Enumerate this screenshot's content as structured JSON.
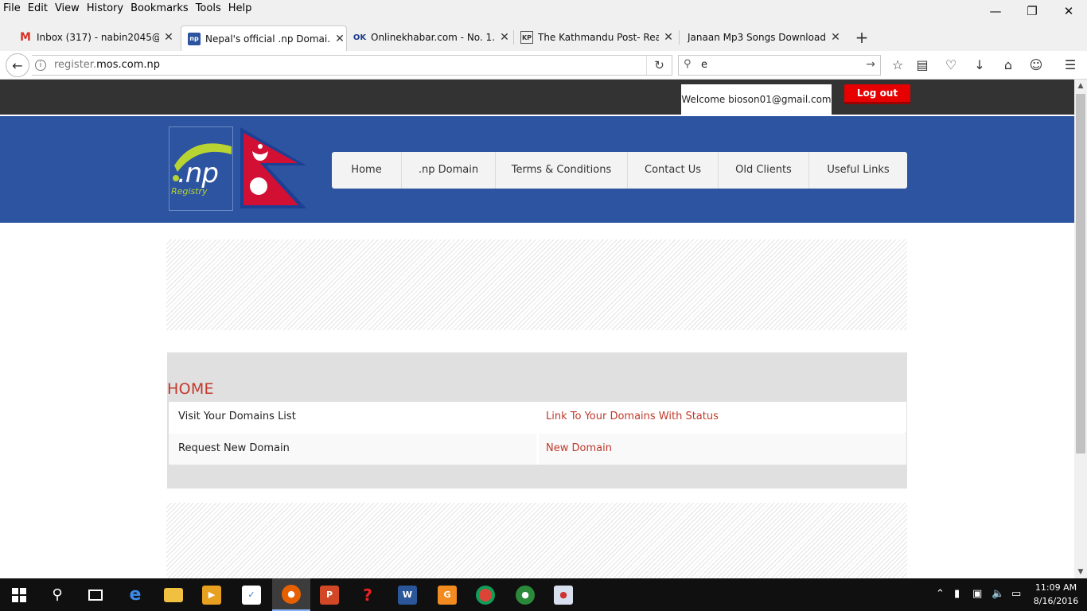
{
  "menubar": {
    "items": [
      "File",
      "Edit",
      "View",
      "History",
      "Bookmarks",
      "Tools",
      "Help"
    ]
  },
  "tabs": [
    {
      "title": "Inbox (317) - nabin2045@...",
      "favicon": "gmail-icon",
      "active": false
    },
    {
      "title": "Nepal's official .np Domai...",
      "favicon": "np-registry-icon",
      "active": true
    },
    {
      "title": "Onlinekhabar.com - No. 1...",
      "favicon": "onlinekhabar-icon",
      "active": false
    },
    {
      "title": "The Kathmandu Post- Rea...",
      "favicon": "kathmandu-post-icon",
      "active": false
    },
    {
      "title": "Janaan Mp3 Songs Download ...",
      "favicon": "blank-page-icon",
      "active": false
    }
  ],
  "navbar": {
    "url_prefix": "register.",
    "url_domain": "mos.com.np",
    "search_value": "e"
  },
  "page": {
    "welcome": "Welcome bioson01@gmail.com",
    "logout": "Log out",
    "logo_text": ".np",
    "logo_sub": "Registry",
    "nav": [
      "Home",
      ".np Domain",
      "Terms & Conditions",
      "Contact Us",
      "Old Clients",
      "Useful Links"
    ],
    "section_title": "HOME",
    "rows": [
      {
        "label": "Visit Your Domains List",
        "link": "Link To Your Domains With Status"
      },
      {
        "label": "Request New Domain",
        "link": "New Domain"
      }
    ]
  },
  "taskbar": {
    "time": "11:09 AM",
    "date": "8/16/2016"
  },
  "colors": {
    "header_blue": "#2c54a0",
    "accent_red": "#c0392b",
    "logout_red": "#e60000",
    "topstrip": "#333333"
  }
}
